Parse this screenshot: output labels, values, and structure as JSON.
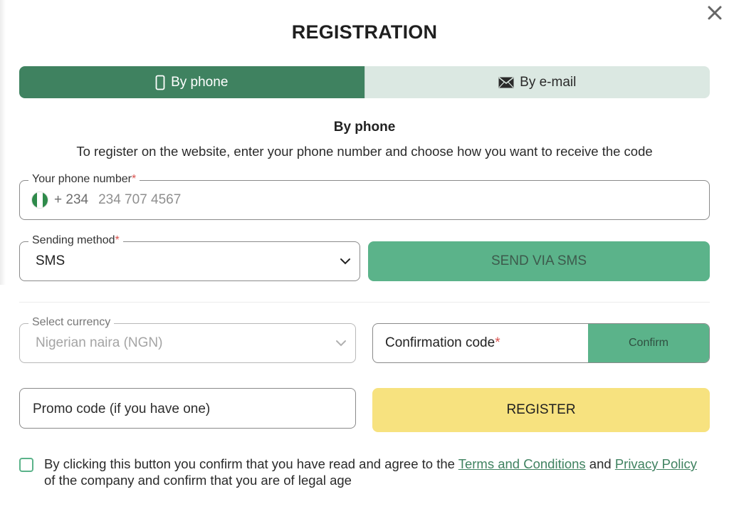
{
  "dialog": {
    "title": "REGISTRATION",
    "close_icon": "close-icon"
  },
  "tabs": [
    {
      "label": "By phone",
      "icon": "phone-icon",
      "active": true
    },
    {
      "label": "By e-mail",
      "icon": "envelope-icon",
      "active": false
    }
  ],
  "section": {
    "heading": "By phone",
    "description": "To register on the website, enter your phone number and choose how you want to receive the code"
  },
  "phone_field": {
    "label": "Your phone number",
    "required_mark": "*",
    "country_flag": "nigeria-flag-icon",
    "country_code": "+ 234",
    "placeholder": "234 707 4567"
  },
  "sending_method": {
    "label": "Sending method",
    "required_mark": "*",
    "value": "SMS"
  },
  "send_button": {
    "label": "SEND VIA SMS"
  },
  "currency": {
    "label": "Select currency",
    "value": "Nigerian naira (NGN)"
  },
  "confirmation": {
    "label": "Confirmation code",
    "required_mark": "*",
    "button_label": "Confirm"
  },
  "promo": {
    "placeholder": "Promo code (if you have one)"
  },
  "register_button": {
    "label": "REGISTER"
  },
  "consent": {
    "text_before": "By clicking this button you confirm that you have read and agree to the ",
    "terms_link": "Terms and Conditions",
    "text_middle": " and ",
    "privacy_link": "Privacy Policy",
    "text_after": " of the company and confirm that you are of legal age"
  },
  "colors": {
    "primary_green": "#3f8260",
    "accent_green": "#5bb38a",
    "tab_inactive": "#dbe8e2",
    "register_yellow": "#f7e27f"
  }
}
